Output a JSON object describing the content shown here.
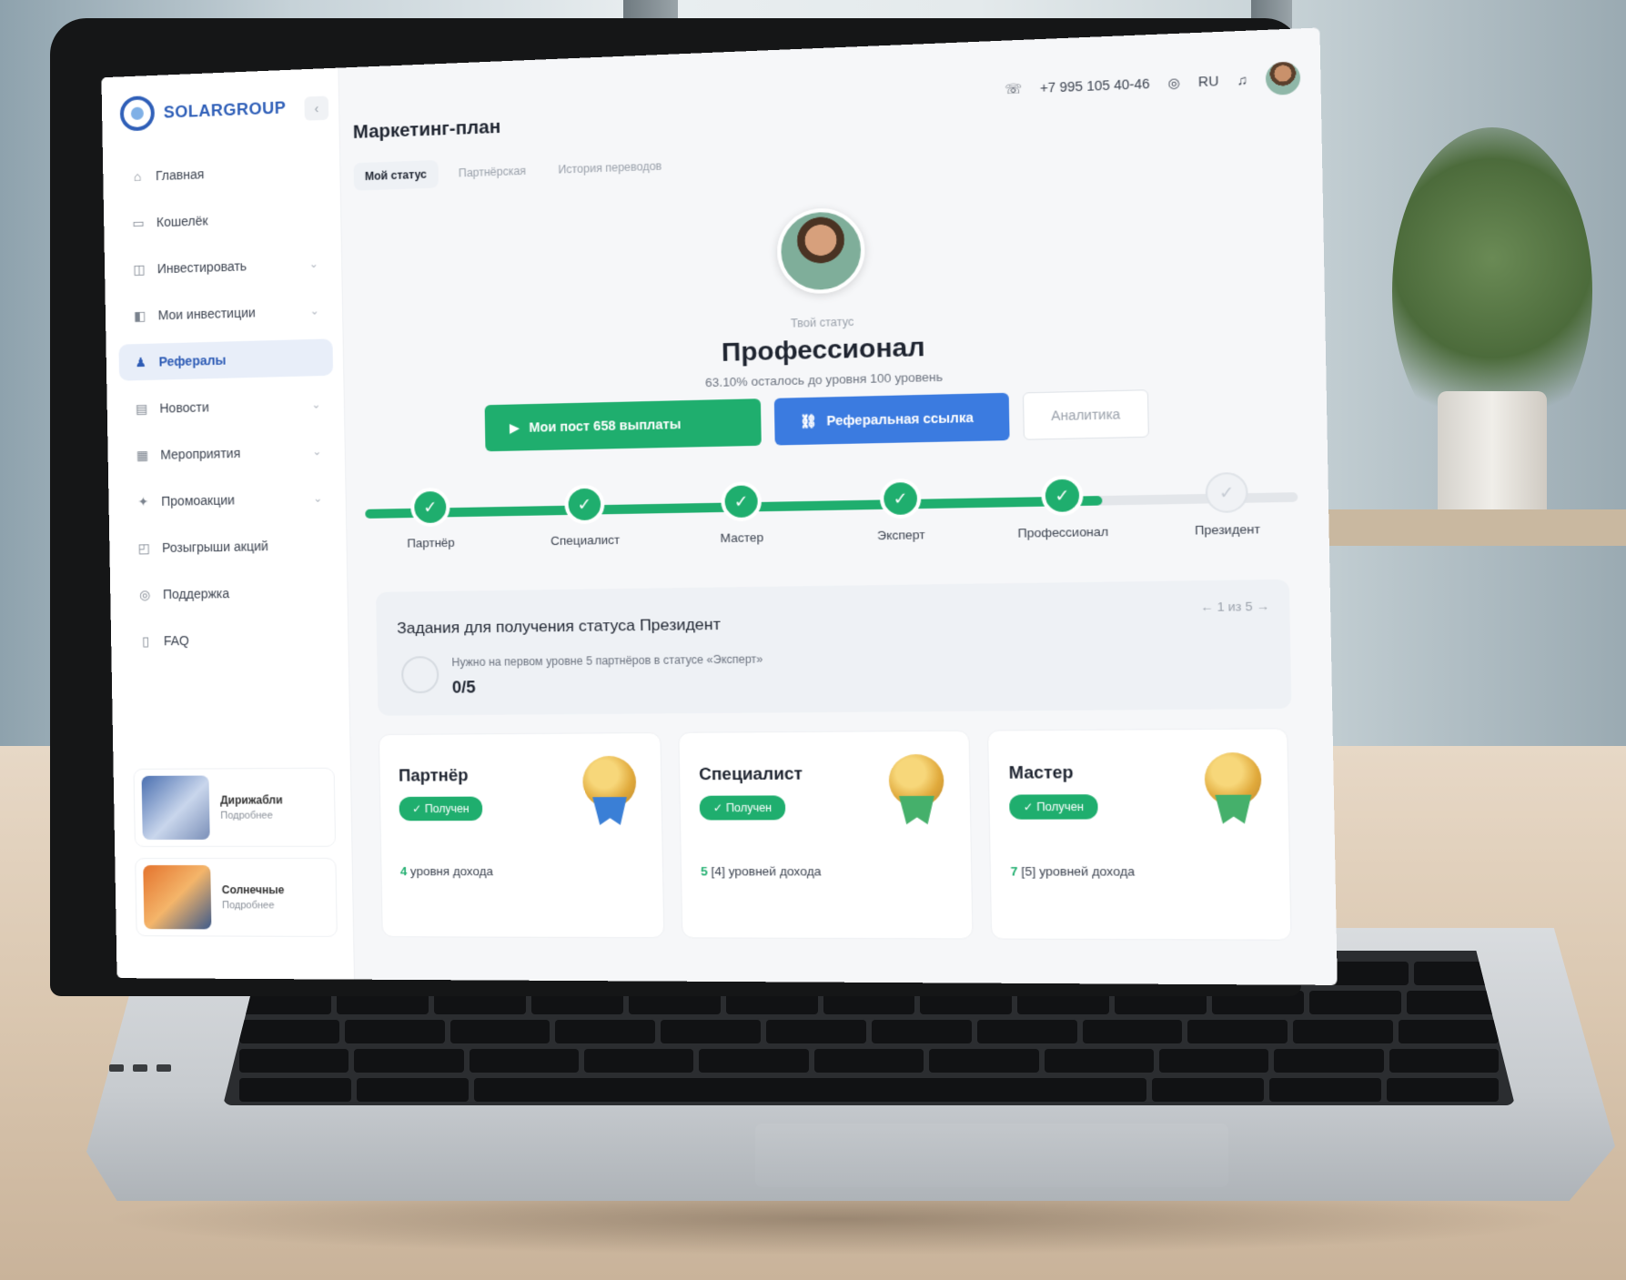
{
  "app": {
    "logo_text": "SOLARGROUP",
    "collapse_icon": "‹"
  },
  "sidebar": {
    "items": [
      {
        "label": "Главная",
        "icon": "home-icon",
        "glyph": "⌂",
        "chevron": false,
        "active": false
      },
      {
        "label": "Кошелёк",
        "icon": "wallet-icon",
        "glyph": "▭",
        "chevron": false,
        "active": false
      },
      {
        "label": "Инвестировать",
        "icon": "invest-icon",
        "glyph": "◫",
        "chevron": true,
        "active": false
      },
      {
        "label": "Мои инвестиции",
        "icon": "portfolio-icon",
        "glyph": "◧",
        "chevron": true,
        "active": false
      },
      {
        "label": "Рефералы",
        "icon": "referrals-icon",
        "glyph": "♟",
        "chevron": false,
        "active": true
      },
      {
        "label": "Новости",
        "icon": "news-icon",
        "glyph": "▤",
        "chevron": true,
        "active": false
      },
      {
        "label": "Мероприятия",
        "icon": "calendar-icon",
        "glyph": "▦",
        "chevron": true,
        "active": false
      },
      {
        "label": "Промоакции",
        "icon": "promo-icon",
        "glyph": "✦",
        "chevron": true,
        "active": false
      },
      {
        "label": "Розыгрыши акций",
        "icon": "gift-icon",
        "glyph": "◰",
        "chevron": false,
        "active": false
      },
      {
        "label": "Поддержка",
        "icon": "support-icon",
        "glyph": "◎",
        "chevron": false,
        "active": false
      },
      {
        "label": "FAQ",
        "icon": "book-icon",
        "glyph": "▯",
        "chevron": false,
        "active": false
      }
    ],
    "promos": [
      {
        "title": "Дирижабли",
        "subtitle": "Подробнее"
      },
      {
        "title": "Солнечные",
        "subtitle": "Подробнее"
      }
    ]
  },
  "header": {
    "phone": "+7 995 105 40-46",
    "language": "RU",
    "phone_icon": "phone-icon",
    "language_icon": "globe-icon",
    "notification_icon": "bell-icon"
  },
  "main": {
    "page_title": "Маркетинг-план",
    "tabs": [
      {
        "label": "Мой статус",
        "active": true
      },
      {
        "label": "Партнёрская",
        "active": false
      },
      {
        "label": "История переводов",
        "active": false
      }
    ]
  },
  "profile": {
    "status_label": "Твой статус",
    "status_name": "Профессионал",
    "status_sub": "63.10% осталось до уровня 100 уровень"
  },
  "actions": {
    "primary": "Мои пост 658 выплаты",
    "referral": "Реферальная ссылка",
    "secondary": "Аналитика"
  },
  "progress": {
    "completed": 5,
    "total": 6,
    "steps": [
      {
        "name": "Партнёр",
        "done": true
      },
      {
        "name": "Специалист",
        "done": true
      },
      {
        "name": "Мастер",
        "done": true
      },
      {
        "name": "Эксперт",
        "done": true
      },
      {
        "name": "Профессионал",
        "done": true
      },
      {
        "name": "Президент",
        "done": false
      }
    ]
  },
  "tasks": {
    "title": "Задания для получения статуса Президент",
    "pager": "← 1 из 5 →",
    "description": "Нужно на первом уровне 5 партнёров в статусе «Эксперт»",
    "count": "0/5"
  },
  "cards": [
    {
      "name": "Партнёр",
      "badge": "✓ Получен",
      "req_num": "4",
      "req_text": "уровня дохода",
      "ribbon": "blue"
    },
    {
      "name": "Специалист",
      "badge": "✓ Получен",
      "req_num": "5",
      "req_text": "[4] уровней дохода",
      "ribbon": "green"
    },
    {
      "name": "Мастер",
      "badge": "✓ Получен",
      "req_num": "7",
      "req_text": "[5] уровней дохода",
      "ribbon": "green"
    }
  ],
  "colors": {
    "accent_green": "#1fae6e",
    "accent_blue": "#3b7be0",
    "brand_blue": "#2f5fb8"
  }
}
